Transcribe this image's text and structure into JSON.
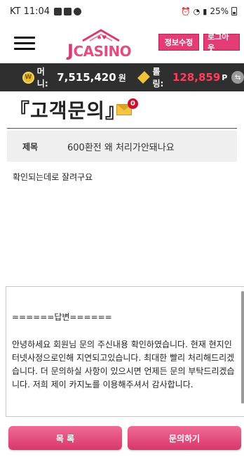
{
  "status_bar": {
    "time": "KT 11:04",
    "battery": "25%"
  },
  "header": {
    "logo_text_j": "J",
    "logo_text_rest": "CASINO",
    "edit_button": "정보수정",
    "logout_button": "로그아웃"
  },
  "money_bar": {
    "coin_symbol": "W",
    "money_label": "머니:",
    "money_value": "7,515,420",
    "money_unit": "원",
    "rolling_label": "롤링:",
    "rolling_value": "128,859",
    "rolling_unit": "P",
    "exchange_icon": "⇆"
  },
  "page": {
    "title": "『고객문의』",
    "mail_badge": "0",
    "subject_label": "제목",
    "subject_value": "600환전 왜 처리가안돼나요",
    "body": "확인되는데로 잘려구요"
  },
  "answer": {
    "heading": "======답변======",
    "text": "안녕하세요 회원님 문의 주신내용 확인하였습니다. 현재 현지인터넷사정으로인해 지연되고있습니다. 최대한 빨리 처리해드리겠습니다. 더 문의하실 사항이 있으시면 언제든 문의 부탁드리겠습니다. 저희 제이 카지노를 이용해주셔서 감사합니다."
  },
  "buttons": {
    "list": "목 록",
    "ask": "문의하기"
  },
  "colors": {
    "accent": "#e23d74",
    "money_bar": "#2f2f2f",
    "rolling_value": "#ff3b5f"
  }
}
